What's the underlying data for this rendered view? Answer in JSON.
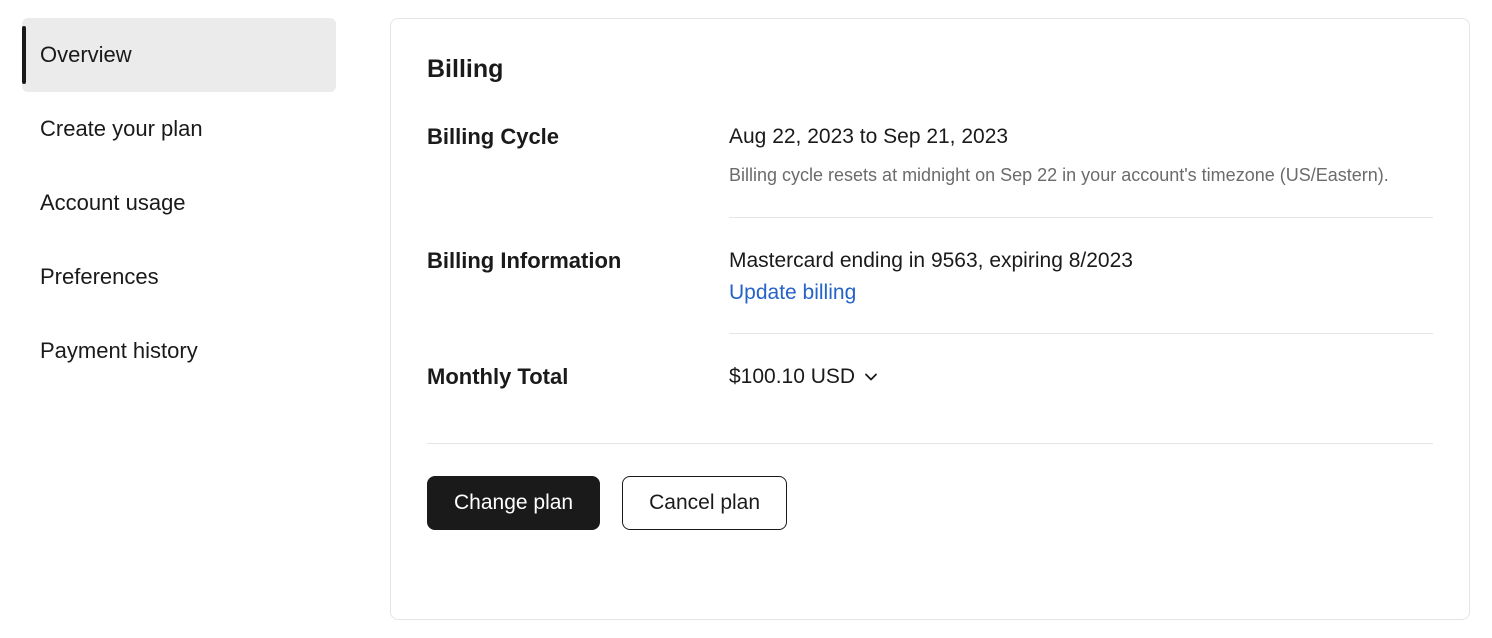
{
  "sidebar": {
    "items": [
      {
        "label": "Overview",
        "active": true
      },
      {
        "label": "Create your plan",
        "active": false
      },
      {
        "label": "Account usage",
        "active": false
      },
      {
        "label": "Preferences",
        "active": false
      },
      {
        "label": "Payment history",
        "active": false
      }
    ]
  },
  "card": {
    "title": "Billing",
    "cycle": {
      "label": "Billing Cycle",
      "range": "Aug 22, 2023 to Sep 21, 2023",
      "note": "Billing cycle resets at midnight on Sep 22 in your account's timezone (US/Eastern)."
    },
    "info": {
      "label": "Billing Information",
      "card_line": "Mastercard ending in 9563, expiring 8/2023",
      "update_link": "Update billing"
    },
    "total": {
      "label": "Monthly Total",
      "amount": "$100.10 USD"
    },
    "actions": {
      "change": "Change plan",
      "cancel": "Cancel plan"
    }
  }
}
